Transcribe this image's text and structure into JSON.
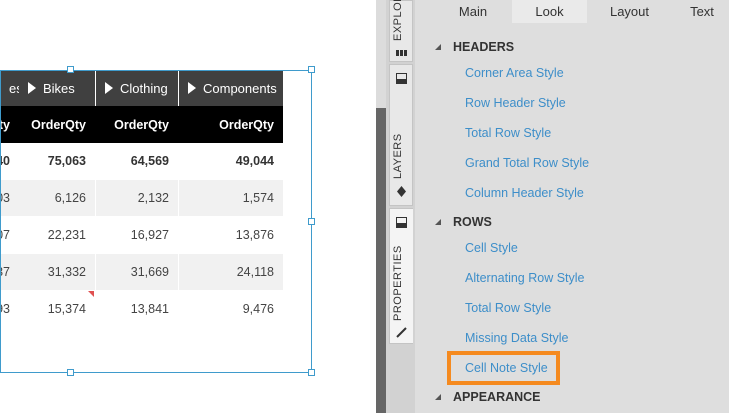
{
  "canvas": {
    "group_headers": [
      {
        "label": "es",
        "expander": false
      },
      {
        "label": "Bikes",
        "expander": true
      },
      {
        "label": "Clothing",
        "expander": true
      },
      {
        "label": "Components",
        "expander": true
      }
    ],
    "column_headers": [
      "Qty",
      "OrderQty",
      "OrderQty",
      "OrderQty"
    ],
    "rows": [
      {
        "type": "total",
        "cells": [
          "40",
          "75,063",
          "64,569",
          "49,044"
        ]
      },
      {
        "type": "odd",
        "cells": [
          "03",
          "6,126",
          "2,132",
          "1,574"
        ]
      },
      {
        "type": "even",
        "cells": [
          "07",
          "22,231",
          "16,927",
          "13,876"
        ]
      },
      {
        "type": "odd",
        "cells": [
          "37",
          "31,332",
          "31,669",
          "24,118"
        ]
      },
      {
        "type": "even",
        "cells": [
          "93",
          "15,374",
          "13,841",
          "9,476"
        ]
      }
    ]
  },
  "side_tabs": {
    "explorer": "EXPLOR",
    "layers": "LAYERS",
    "properties": "PROPERTIES"
  },
  "panel": {
    "tabs": [
      "Main",
      "Look",
      "Layout",
      "Text"
    ],
    "active_tab": "Look",
    "sections": [
      {
        "title": "HEADERS",
        "items": [
          "Corner Area Style",
          "Row Header Style",
          "Total Row Style",
          "Grand Total Row Style",
          "Column Header Style"
        ]
      },
      {
        "title": "ROWS",
        "items": [
          "Cell Style",
          "Alternating Row Style",
          "Total Row Style",
          "Missing Data Style",
          "Cell Note Style"
        ]
      },
      {
        "title": "APPEARANCE",
        "items": []
      }
    ],
    "highlighted_item": "Cell Note Style"
  },
  "colors": {
    "link": "#3d8ec9",
    "highlight": "#f58a1f",
    "selection": "#3f9bcc",
    "header_bg": "#404040",
    "column_header_bg": "#000000"
  }
}
